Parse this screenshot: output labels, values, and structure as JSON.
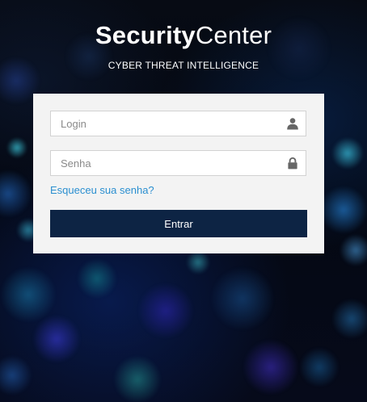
{
  "brand": {
    "name_bold": "Security",
    "name_light": "Center",
    "tagline": "CYBER THREAT INTELLIGENCE"
  },
  "login_form": {
    "login_placeholder": "Login",
    "login_icon": "user-icon",
    "password_placeholder": "Senha",
    "password_icon": "lock-icon",
    "forgot_link": "Esqueceu sua senha?",
    "submit_label": "Entrar"
  },
  "colors": {
    "panel_bg": "#f3f3f3",
    "button_bg": "#0d2444",
    "link": "#2b8fd0",
    "icon": "#666666"
  }
}
